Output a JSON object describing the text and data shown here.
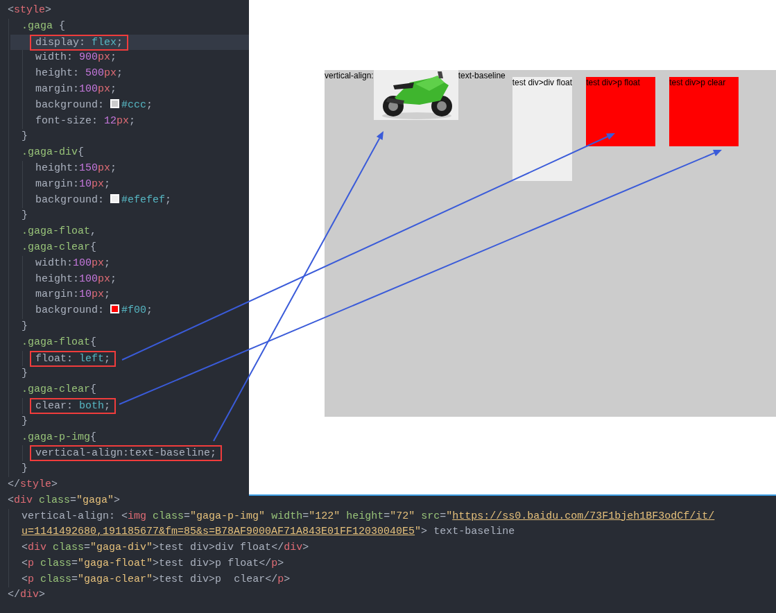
{
  "editor": {
    "lines": [
      {
        "tokens": [
          {
            "kind": "punct",
            "text": "<"
          },
          {
            "kind": "tag",
            "text": "style"
          },
          {
            "kind": "punct",
            "text": ">"
          }
        ],
        "children": [
          {
            "tokens": [
              {
                "kind": "selector",
                "text": ".gaga"
              },
              {
                "kind": "punct",
                "text": " {"
              }
            ],
            "children": [
              {
                "highlighted": true,
                "boxed": true,
                "tokens": [
                  {
                    "kind": "prop",
                    "text": "display"
                  },
                  {
                    "kind": "punct",
                    "text": ": "
                  },
                  {
                    "kind": "value",
                    "text": "flex"
                  },
                  {
                    "kind": "punct",
                    "text": ";"
                  }
                ]
              },
              {
                "tokens": [
                  {
                    "kind": "prop",
                    "text": "width"
                  },
                  {
                    "kind": "punct",
                    "text": ": "
                  },
                  {
                    "kind": "number",
                    "text": "900"
                  },
                  {
                    "kind": "unit",
                    "text": "px"
                  },
                  {
                    "kind": "punct",
                    "text": ";"
                  }
                ]
              },
              {
                "tokens": [
                  {
                    "kind": "prop",
                    "text": "height"
                  },
                  {
                    "kind": "punct",
                    "text": ": "
                  },
                  {
                    "kind": "number",
                    "text": "500"
                  },
                  {
                    "kind": "unit",
                    "text": "px"
                  },
                  {
                    "kind": "punct",
                    "text": ";"
                  }
                ]
              },
              {
                "tokens": [
                  {
                    "kind": "prop",
                    "text": "margin"
                  },
                  {
                    "kind": "punct",
                    "text": ":"
                  },
                  {
                    "kind": "number",
                    "text": "100"
                  },
                  {
                    "kind": "unit",
                    "text": "px"
                  },
                  {
                    "kind": "punct",
                    "text": ";"
                  }
                ]
              },
              {
                "tokens": [
                  {
                    "kind": "prop",
                    "text": "background"
                  },
                  {
                    "kind": "punct",
                    "text": ": "
                  },
                  {
                    "kind": "hex",
                    "text": "#ccc",
                    "color": "#cccccc"
                  },
                  {
                    "kind": "punct",
                    "text": ";"
                  }
                ]
              },
              {
                "tokens": [
                  {
                    "kind": "prop",
                    "text": "font-size"
                  },
                  {
                    "kind": "punct",
                    "text": ": "
                  },
                  {
                    "kind": "number",
                    "text": "12"
                  },
                  {
                    "kind": "unit",
                    "text": "px"
                  },
                  {
                    "kind": "punct",
                    "text": ";"
                  }
                ]
              }
            ]
          },
          {
            "tokens": [
              {
                "kind": "punct",
                "text": "}"
              }
            ]
          },
          {
            "tokens": [
              {
                "kind": "selector",
                "text": ".gaga-div"
              },
              {
                "kind": "punct",
                "text": "{"
              }
            ],
            "children": [
              {
                "tokens": [
                  {
                    "kind": "prop",
                    "text": "height"
                  },
                  {
                    "kind": "punct",
                    "text": ":"
                  },
                  {
                    "kind": "number",
                    "text": "150"
                  },
                  {
                    "kind": "unit",
                    "text": "px"
                  },
                  {
                    "kind": "punct",
                    "text": ";"
                  }
                ]
              },
              {
                "tokens": [
                  {
                    "kind": "prop",
                    "text": "margin"
                  },
                  {
                    "kind": "punct",
                    "text": ":"
                  },
                  {
                    "kind": "number",
                    "text": "10"
                  },
                  {
                    "kind": "unit",
                    "text": "px"
                  },
                  {
                    "kind": "punct",
                    "text": ";"
                  }
                ]
              },
              {
                "tokens": [
                  {
                    "kind": "prop",
                    "text": "background"
                  },
                  {
                    "kind": "punct",
                    "text": ": "
                  },
                  {
                    "kind": "hex",
                    "text": "#efefef",
                    "color": "#efefef"
                  },
                  {
                    "kind": "punct",
                    "text": ";"
                  }
                ]
              }
            ]
          },
          {
            "tokens": [
              {
                "kind": "punct",
                "text": "}"
              }
            ]
          },
          {
            "tokens": [
              {
                "kind": "selector",
                "text": ".gaga-float"
              },
              {
                "kind": "punct",
                "text": ","
              }
            ]
          },
          {
            "tokens": [
              {
                "kind": "selector",
                "text": ".gaga-clear"
              },
              {
                "kind": "punct",
                "text": "{"
              }
            ],
            "children": [
              {
                "tokens": [
                  {
                    "kind": "prop",
                    "text": "width"
                  },
                  {
                    "kind": "punct",
                    "text": ":"
                  },
                  {
                    "kind": "number",
                    "text": "100"
                  },
                  {
                    "kind": "unit",
                    "text": "px"
                  },
                  {
                    "kind": "punct",
                    "text": ";"
                  }
                ]
              },
              {
                "tokens": [
                  {
                    "kind": "prop",
                    "text": "height"
                  },
                  {
                    "kind": "punct",
                    "text": ":"
                  },
                  {
                    "kind": "number",
                    "text": "100"
                  },
                  {
                    "kind": "unit",
                    "text": "px"
                  },
                  {
                    "kind": "punct",
                    "text": ";"
                  }
                ]
              },
              {
                "tokens": [
                  {
                    "kind": "prop",
                    "text": "margin"
                  },
                  {
                    "kind": "punct",
                    "text": ":"
                  },
                  {
                    "kind": "number",
                    "text": "10"
                  },
                  {
                    "kind": "unit",
                    "text": "px"
                  },
                  {
                    "kind": "punct",
                    "text": ";"
                  }
                ]
              },
              {
                "tokens": [
                  {
                    "kind": "prop",
                    "text": "background"
                  },
                  {
                    "kind": "punct",
                    "text": ": "
                  },
                  {
                    "kind": "hex",
                    "text": "#f00",
                    "color": "#ff0000"
                  },
                  {
                    "kind": "punct",
                    "text": ";"
                  }
                ]
              }
            ]
          },
          {
            "tokens": [
              {
                "kind": "punct",
                "text": "}"
              }
            ]
          },
          {
            "tokens": [
              {
                "kind": "selector",
                "text": ".gaga-float"
              },
              {
                "kind": "punct",
                "text": "{"
              }
            ],
            "children": [
              {
                "boxed": true,
                "tokens": [
                  {
                    "kind": "prop",
                    "text": "float"
                  },
                  {
                    "kind": "punct",
                    "text": ": "
                  },
                  {
                    "kind": "value",
                    "text": "left"
                  },
                  {
                    "kind": "punct",
                    "text": ";"
                  }
                ]
              }
            ]
          },
          {
            "tokens": [
              {
                "kind": "punct",
                "text": "}"
              }
            ]
          },
          {
            "tokens": [
              {
                "kind": "selector",
                "text": ".gaga-clear"
              },
              {
                "kind": "punct",
                "text": "{"
              }
            ],
            "children": [
              {
                "boxed": true,
                "tokens": [
                  {
                    "kind": "prop",
                    "text": "clear"
                  },
                  {
                    "kind": "punct",
                    "text": ": "
                  },
                  {
                    "kind": "value",
                    "text": "both"
                  },
                  {
                    "kind": "punct",
                    "text": ";"
                  }
                ]
              }
            ]
          },
          {
            "tokens": [
              {
                "kind": "punct",
                "text": "}"
              }
            ]
          },
          {
            "tokens": [
              {
                "kind": "selector",
                "text": ".gaga-p-img"
              },
              {
                "kind": "punct",
                "text": "{"
              }
            ],
            "children": [
              {
                "boxed": true,
                "tokens": [
                  {
                    "kind": "prop",
                    "text": "vertical-align:text-baseline;"
                  }
                ]
              }
            ]
          },
          {
            "tokens": [
              {
                "kind": "punct",
                "text": "}"
              }
            ]
          }
        ]
      },
      {
        "tokens": [
          {
            "kind": "punct",
            "text": "</"
          },
          {
            "kind": "tag",
            "text": "style"
          },
          {
            "kind": "punct",
            "text": ">"
          }
        ]
      },
      {
        "tokens": [
          {
            "kind": "punct",
            "text": "<"
          },
          {
            "kind": "tag",
            "text": "div"
          },
          {
            "kind": "attr",
            "text": " class"
          },
          {
            "kind": "punct",
            "text": "="
          },
          {
            "kind": "string",
            "text": "\"gaga\""
          },
          {
            "kind": "punct",
            "text": ">"
          }
        ],
        "children": [
          {
            "tokens": [
              {
                "kind": "text",
                "text": "vertical-align: "
              },
              {
                "kind": "punct",
                "text": "<"
              },
              {
                "kind": "tag",
                "text": "img"
              },
              {
                "kind": "attr",
                "text": " class"
              },
              {
                "kind": "punct",
                "text": "="
              },
              {
                "kind": "string",
                "text": "\"gaga-p-img\""
              },
              {
                "kind": "attr",
                "text": " width"
              },
              {
                "kind": "punct",
                "text": "="
              },
              {
                "kind": "string",
                "text": "\"122\""
              },
              {
                "kind": "attr",
                "text": " height"
              },
              {
                "kind": "punct",
                "text": "="
              },
              {
                "kind": "string",
                "text": "\"72\""
              },
              {
                "kind": "attr",
                "text": " src"
              },
              {
                "kind": "punct",
                "text": "="
              },
              {
                "kind": "string",
                "text": "\""
              },
              {
                "kind": "link",
                "text": "https://ss0.baidu.com/73F1bjeh1BF3odCf/it/"
              }
            ]
          },
          {
            "tokens": [
              {
                "kind": "link",
                "text": "u=1141492680,191185677&fm=85&s=B78AF9000AF71A843E01FF12030040E5"
              },
              {
                "kind": "string",
                "text": "\""
              },
              {
                "kind": "punct",
                "text": ">"
              },
              {
                "kind": "text",
                "text": " text-baseline"
              }
            ]
          },
          {
            "tokens": [
              {
                "kind": "punct",
                "text": "<"
              },
              {
                "kind": "tag",
                "text": "div"
              },
              {
                "kind": "attr",
                "text": " class"
              },
              {
                "kind": "punct",
                "text": "="
              },
              {
                "kind": "string",
                "text": "\"gaga-div\""
              },
              {
                "kind": "punct",
                "text": ">"
              },
              {
                "kind": "text",
                "text": "test div>div float"
              },
              {
                "kind": "punct",
                "text": "</"
              },
              {
                "kind": "tag",
                "text": "div"
              },
              {
                "kind": "punct",
                "text": ">"
              }
            ]
          },
          {
            "tokens": [
              {
                "kind": "punct",
                "text": "<"
              },
              {
                "kind": "tag",
                "text": "p"
              },
              {
                "kind": "attr",
                "text": " class"
              },
              {
                "kind": "punct",
                "text": "="
              },
              {
                "kind": "string",
                "text": "\"gaga-float\""
              },
              {
                "kind": "punct",
                "text": ">"
              },
              {
                "kind": "text",
                "text": "test div>p float"
              },
              {
                "kind": "punct",
                "text": "</"
              },
              {
                "kind": "tag",
                "text": "p"
              },
              {
                "kind": "punct",
                "text": ">"
              }
            ]
          },
          {
            "tokens": [
              {
                "kind": "punct",
                "text": "<"
              },
              {
                "kind": "tag",
                "text": "p"
              },
              {
                "kind": "attr",
                "text": " class"
              },
              {
                "kind": "punct",
                "text": "="
              },
              {
                "kind": "string",
                "text": "\"gaga-clear\""
              },
              {
                "kind": "punct",
                "text": ">"
              },
              {
                "kind": "text",
                "text": "test div>p  clear"
              },
              {
                "kind": "punct",
                "text": "</"
              },
              {
                "kind": "tag",
                "text": "p"
              },
              {
                "kind": "punct",
                "text": ">"
              }
            ]
          }
        ]
      },
      {
        "tokens": [
          {
            "kind": "punct",
            "text": "</"
          },
          {
            "kind": "tag",
            "text": "div"
          },
          {
            "kind": "punct",
            "text": ">"
          }
        ]
      }
    ]
  },
  "preview": {
    "text_before": "vertical-align:",
    "text_after": "text-baseline",
    "boxes": [
      {
        "kind": "div",
        "text": "test div>div float",
        "color": "#efefef"
      },
      {
        "kind": "p",
        "text": "test div>p float",
        "color": "#ff0000"
      },
      {
        "kind": "p",
        "text": "test div>p clear",
        "color": "#ff0000"
      }
    ]
  }
}
